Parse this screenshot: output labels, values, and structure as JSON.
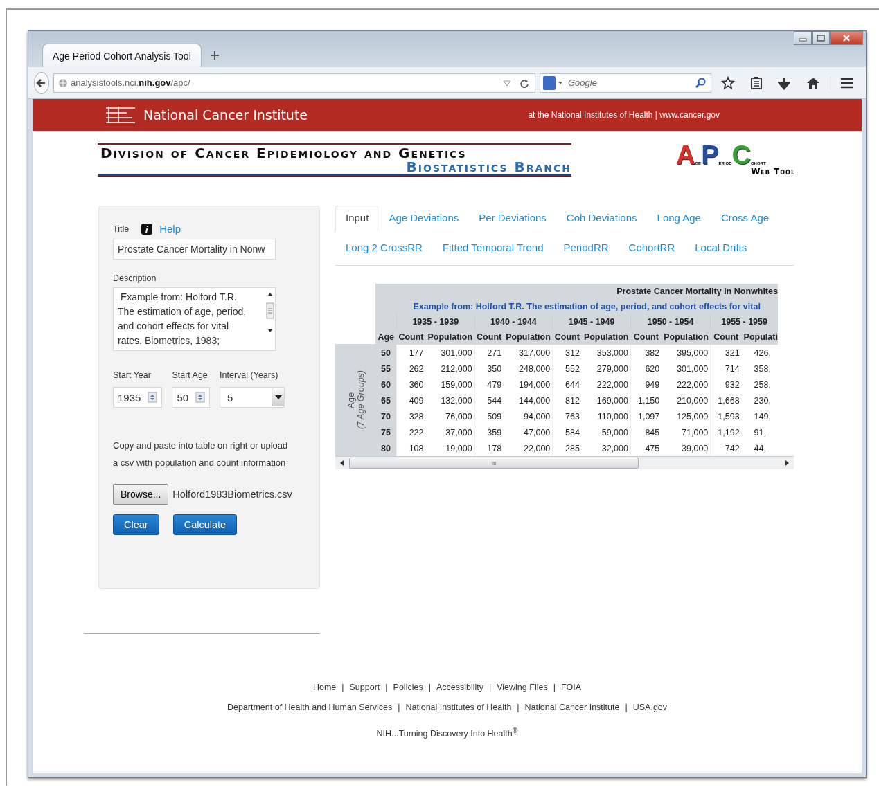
{
  "browser": {
    "tab_title": "Age Period Cohort Analysis Tool",
    "url": "analysistools.nci.**nih.gov**/apc/",
    "search_placeholder": "Google"
  },
  "banner": {
    "title": "National Cancer Institute",
    "tagline": "at the National Institutes of Health | www.cancer.gov"
  },
  "header": {
    "division": "Division of Cancer Epidemiology and Genetics",
    "branch": "Biostatistics Branch",
    "logo": {
      "letters": [
        {
          "big": "A",
          "small": "ge",
          "color": "#d8312a"
        },
        {
          "big": "P",
          "small": "eriod",
          "color": "#1f4fa8"
        },
        {
          "big": "C",
          "small": "ohort",
          "color": "#3aa13a"
        }
      ],
      "caption": "Web Tool"
    }
  },
  "form": {
    "title_label": "Title",
    "help_link": "Help",
    "title_value": "Prostate Cancer Mortality in Nonw",
    "description_label": "Description",
    "description_value": " Example from: Holford T.R. The estimation of age, period, and cohort effects for vital rates. Biometrics, 1983;",
    "fields": [
      {
        "label": "Start Year",
        "value": "1935",
        "kind": "spinner"
      },
      {
        "label": "Start Age",
        "value": "50",
        "kind": "spinner"
      },
      {
        "label": "Interval (Years)",
        "value": "5",
        "kind": "dropdown"
      }
    ],
    "instructions": "Copy and paste into table on right or upload a csv with population and count information",
    "browse_button": "Browse...",
    "file_name": "Holford1983Biometrics.csv",
    "buttons": [
      "Clear",
      "Calculate"
    ]
  },
  "tabs": [
    [
      {
        "label": "Input",
        "selected": true
      },
      {
        "label": "Age Deviations",
        "selected": false
      },
      {
        "label": "Per Deviations",
        "selected": false
      },
      {
        "label": "Coh Deviations",
        "selected": false
      },
      {
        "label": "Long Age",
        "selected": false
      },
      {
        "label": "Cross Age",
        "selected": false
      }
    ],
    [
      {
        "label": "Long 2 CrossRR",
        "selected": false
      },
      {
        "label": "Fitted Temporal Trend",
        "selected": false
      },
      {
        "label": "PeriodRR",
        "selected": false
      },
      {
        "label": "CohortRR",
        "selected": false
      },
      {
        "label": "Local Drifts",
        "selected": false
      }
    ]
  ],
  "table": {
    "title": "Prostate Cancer Mortality in Nonwhites",
    "subtitle": "Example from: Holford T.R. The estimation of age, period, and cohort effects for vital",
    "side_label": "Age",
    "side_sublabel": "(7 Age Groups)",
    "age_header": "Age",
    "periods": [
      "1935 - 1939",
      "1940 - 1944",
      "1945 - 1949",
      "1950 - 1954",
      "1955 - 1959"
    ],
    "subheaders": [
      "Count",
      "Population",
      "Count",
      "Population",
      "Count",
      "Population",
      "Count",
      "Population",
      "Count",
      "Populati"
    ],
    "rows": [
      {
        "age": "50",
        "values": [
          "177",
          "301,000",
          "271",
          "317,000",
          "312",
          "353,000",
          "382",
          "395,000",
          "321",
          "426,"
        ]
      },
      {
        "age": "55",
        "values": [
          "262",
          "212,000",
          "350",
          "248,000",
          "552",
          "279,000",
          "620",
          "301,000",
          "714",
          "358,"
        ]
      },
      {
        "age": "60",
        "values": [
          "360",
          "159,000",
          "479",
          "194,000",
          "644",
          "222,000",
          "949",
          "222,000",
          "932",
          "258,"
        ]
      },
      {
        "age": "65",
        "values": [
          "409",
          "132,000",
          "544",
          "144,000",
          "812",
          "169,000",
          "1,150",
          "210,000",
          "1,668",
          "230,"
        ]
      },
      {
        "age": "70",
        "values": [
          "328",
          "76,000",
          "509",
          "94,000",
          "763",
          "110,000",
          "1,097",
          "125,000",
          "1,593",
          "149,"
        ]
      },
      {
        "age": "75",
        "values": [
          "222",
          "37,000",
          "359",
          "47,000",
          "584",
          "59,000",
          "845",
          "71,000",
          "1,192",
          "91,"
        ]
      },
      {
        "age": "80",
        "values": [
          "108",
          "19,000",
          "178",
          "22,000",
          "285",
          "32,000",
          "475",
          "39,000",
          "742",
          "44,"
        ]
      }
    ],
    "scroll_grip": "III"
  },
  "footer": {
    "links": [
      "Home",
      "Support",
      "Policies",
      "Accessibility",
      "Viewing Files",
      "FOIA"
    ],
    "link_separators": [
      "|",
      "|",
      "|",
      "|",
      "|"
    ],
    "agency_separators": [
      "|",
      "|",
      "|"
    ],
    "agencies": [
      "Department of Health and Human Services",
      "National Institutes of Health",
      "National Cancer Institute",
      "USA.gov"
    ],
    "slogan": "NIH...Turning Discovery Into Health$^{®}$"
  }
}
